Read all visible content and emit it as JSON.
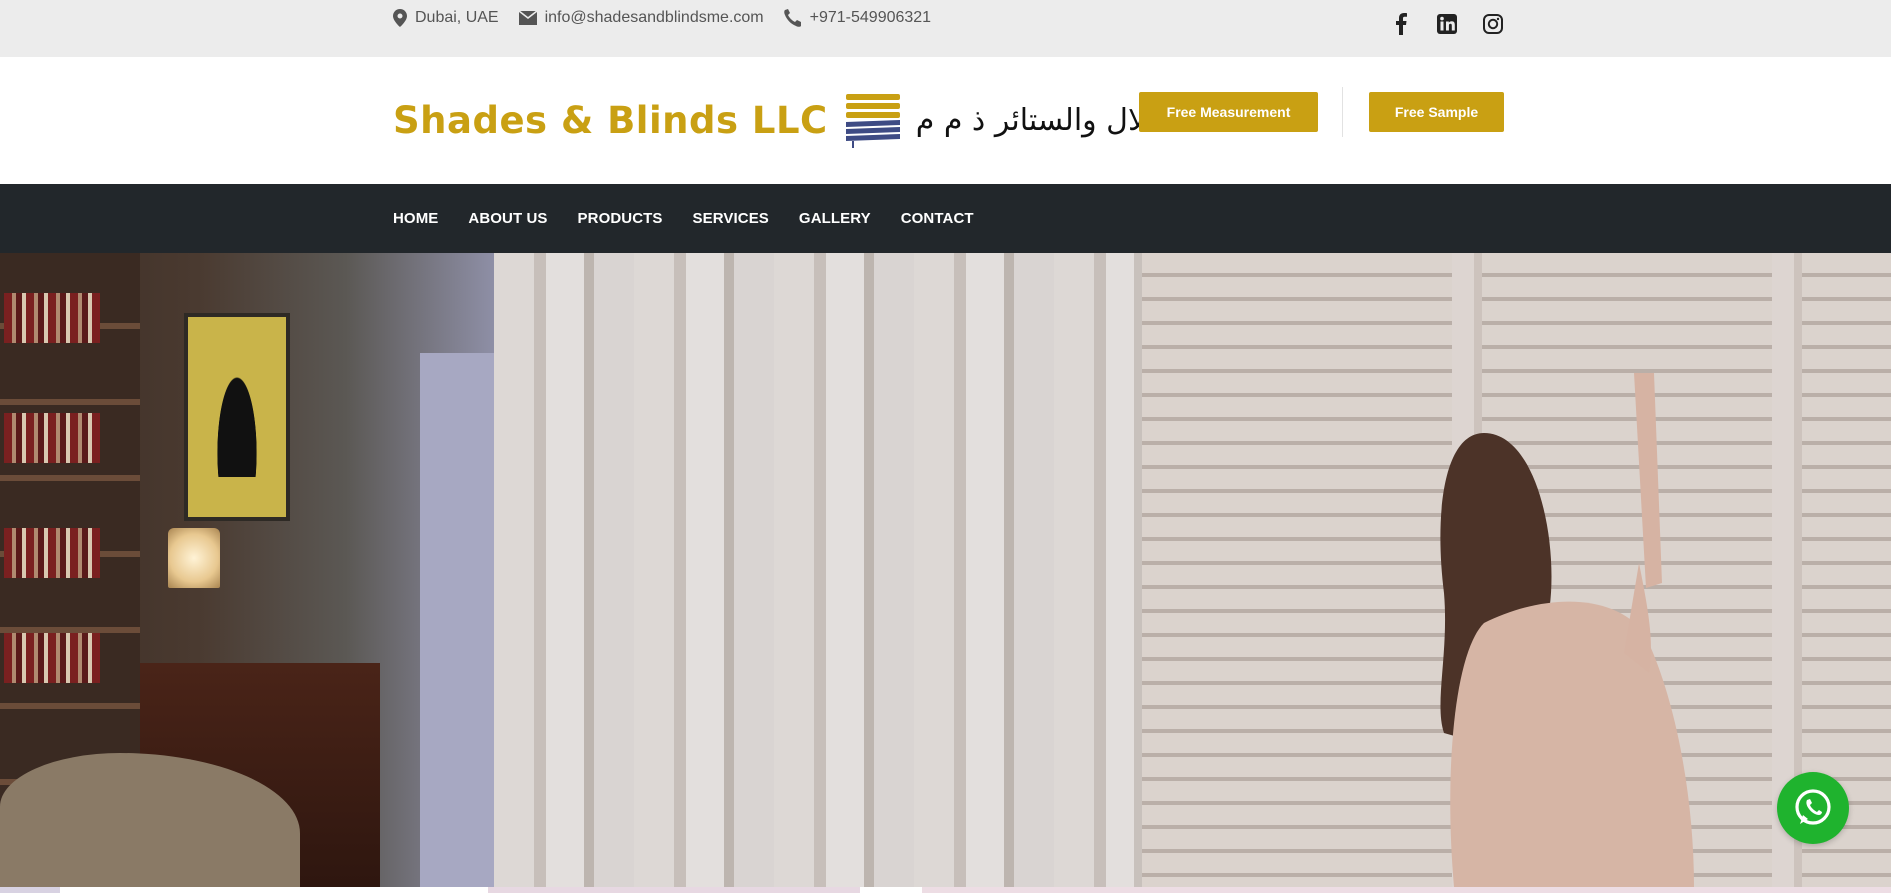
{
  "topbar": {
    "location": "Dubai, UAE",
    "email": "info@shadesandblindsme.com",
    "phone": "+971-549906321",
    "social": [
      "facebook-icon",
      "linkedin-icon",
      "instagram-icon"
    ]
  },
  "header": {
    "brand": "Shades & Blinds LLC",
    "brand_arabic": "الظلال والستائر ذ م م",
    "free_measurement_label": "Free Measurement",
    "free_sample_label": "Free Sample"
  },
  "nav": {
    "items": [
      {
        "label": "HOME"
      },
      {
        "label": "ABOUT US"
      },
      {
        "label": "PRODUCTS"
      },
      {
        "label": "SERVICES"
      },
      {
        "label": "GALLERY"
      },
      {
        "label": "CONTACT"
      }
    ]
  },
  "colors": {
    "accent": "#c9a013",
    "nav_bg": "#22272b",
    "topbar_bg": "#ececec",
    "whatsapp": "#1fb32e"
  },
  "icons": {
    "location": "map-marker-icon",
    "email": "envelope-icon",
    "phone": "phone-icon",
    "whatsapp": "whatsapp-icon"
  }
}
